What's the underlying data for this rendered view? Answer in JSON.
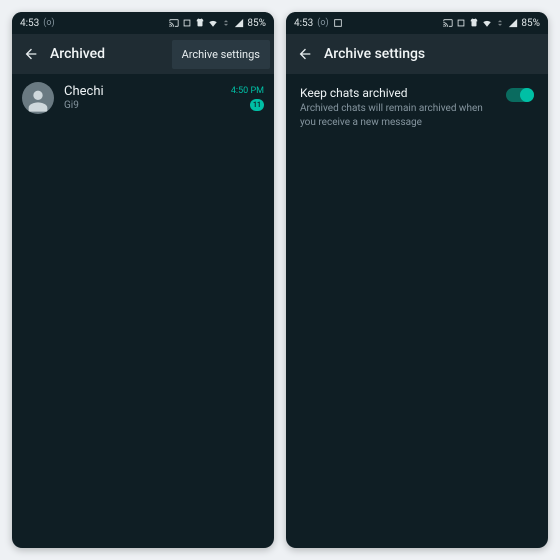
{
  "colors": {
    "bg": "#0f1e24",
    "surface": "#1f2c33",
    "chip": "#2a3942",
    "text": "#e8eef0",
    "muted": "#8696a0",
    "accent": "#00bfa5"
  },
  "left": {
    "status": {
      "time": "4:53",
      "extra": "(o)",
      "battery": "85%"
    },
    "appbar": {
      "title": "Archived",
      "menu": "Archive settings"
    },
    "chats": [
      {
        "name": "Chechi",
        "preview": "Gi9",
        "time": "4:50 PM",
        "unread": "11"
      }
    ]
  },
  "right": {
    "status": {
      "time": "4:53",
      "extra": "(o)",
      "battery": "85%"
    },
    "appbar": {
      "title": "Archive settings"
    },
    "setting": {
      "title": "Keep chats archived",
      "desc": "Archived chats will remain archived when you receive a new message",
      "on": true
    }
  }
}
